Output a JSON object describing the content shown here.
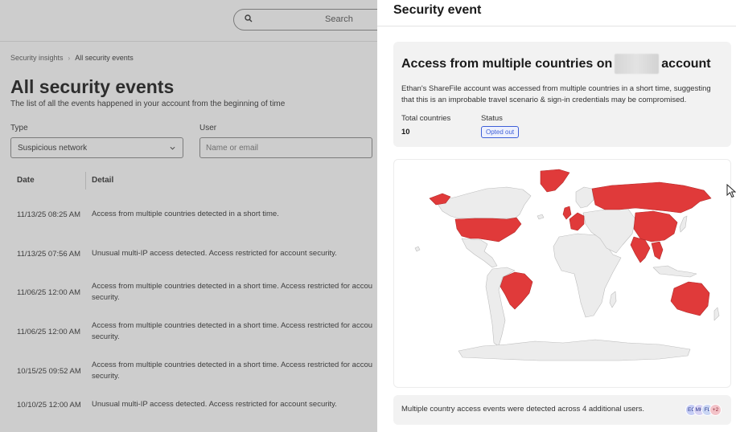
{
  "background": {
    "search_placeholder": "Search",
    "breadcrumb": [
      "Security insights",
      "All security events"
    ],
    "page_title": "All security events",
    "page_subtitle": "The list of all the events happened in your account from the beginning of time",
    "filters": {
      "type_label": "Type",
      "type_value": "Suspicious network",
      "user_label": "User",
      "user_placeholder": "Name or email"
    },
    "table": {
      "columns": [
        "Date",
        "Detail"
      ],
      "rows": [
        {
          "date": "11/13/25 08:25 AM",
          "detail": [
            "Access from multiple countries detected in a short time."
          ]
        },
        {
          "date": "11/13/25 07:56 AM",
          "detail": [
            "Unusual multi-IP access detected. Access restricted for account security."
          ]
        },
        {
          "date": "11/06/25 12:00 AM",
          "detail": [
            "Access from multiple countries detected in a short time. Access restricted for accou",
            "security."
          ]
        },
        {
          "date": "11/06/25 12:00 AM",
          "detail": [
            "Access from multiple countries detected in a short time. Access restricted for accou",
            "security."
          ]
        },
        {
          "date": "10/15/25 09:52 AM",
          "detail": [
            "Access from multiple countries detected in a short time. Access restricted for accou",
            "security."
          ]
        },
        {
          "date": "10/10/25 12:00 AM",
          "detail": [
            "Unusual multi-IP access detected. Access restricted for account security."
          ]
        }
      ]
    }
  },
  "panel": {
    "title": "Security event",
    "event": {
      "title_before": "Access from multiple countries on",
      "title_after": "account",
      "description": "Ethan's ShareFile account was accessed from multiple countries in a short time, suggesting that this is an improbable travel scenario & sign-in credentials may be compromised.",
      "total_countries_label": "Total countries",
      "total_countries_value": "10",
      "status_label": "Status",
      "status_value": "Opted out"
    },
    "map": {
      "highlight_color": "#e03a3a",
      "base_color": "#ececec",
      "highlighted_regions": [
        "Greenland",
        "United States",
        "Brazil",
        "United Kingdom",
        "Western Europe",
        "Russia",
        "China",
        "India",
        "Southeast Asia",
        "Australia"
      ]
    },
    "footer": {
      "text": "Multiple country access events were detected across 4 additional users.",
      "avatars": [
        "EC",
        "MH",
        "FL",
        "+2"
      ]
    }
  }
}
